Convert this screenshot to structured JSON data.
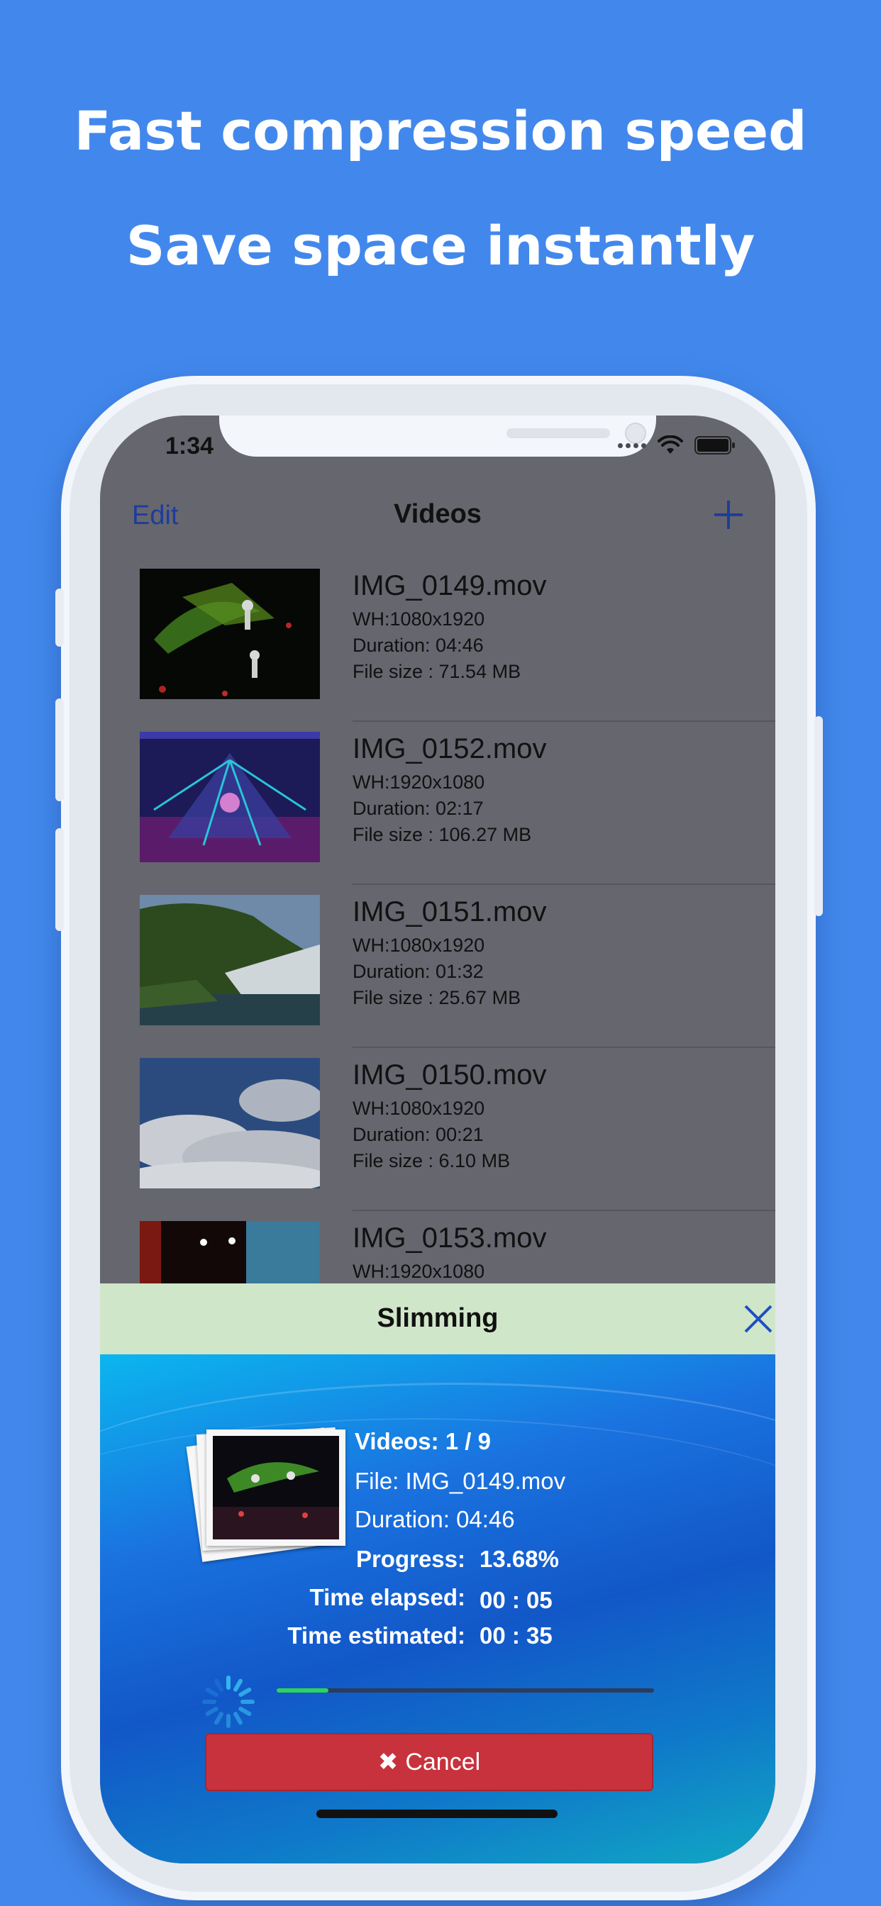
{
  "marketing": {
    "headline1": "Fast compression speed",
    "headline2": "Save space instantly"
  },
  "status_bar": {
    "time": "1:34"
  },
  "nav": {
    "edit": "Edit",
    "title": "Videos",
    "add_icon": "plus-icon"
  },
  "videos": [
    {
      "name": "IMG_0149.mov",
      "wh": "WH:1080x1920",
      "duration": "Duration: 04:46",
      "size": "File size : 71.54 MB"
    },
    {
      "name": "IMG_0152.mov",
      "wh": "WH:1920x1080",
      "duration": "Duration: 02:17",
      "size": "File size : 106.27 MB"
    },
    {
      "name": "IMG_0151.mov",
      "wh": "WH:1080x1920",
      "duration": "Duration: 01:32",
      "size": "File size : 25.67 MB"
    },
    {
      "name": "IMG_0150.mov",
      "wh": "WH:1080x1920",
      "duration": "Duration: 00:21",
      "size": "File size : 6.10 MB"
    },
    {
      "name": "IMG_0153.mov",
      "wh": "WH:1920x1080",
      "duration": "",
      "size": ""
    }
  ],
  "sheet": {
    "title": "Slimming",
    "close_icon": "close-icon",
    "videos_count": "Videos: 1 / 9",
    "file": "File: IMG_0149.mov",
    "duration": "Duration: 04:46",
    "progress_label": "Progress:",
    "progress_value": "13.68%",
    "progress_fraction": 0.1368,
    "elapsed_label": "Time elapsed:",
    "elapsed_value": "00 : 05",
    "estimated_label": "Time estimated:",
    "estimated_value": "00 : 35",
    "cancel_label": "Cancel"
  },
  "colors": {
    "background": "#4288ec",
    "nav_tint": "#1d3d9a",
    "sheet_header": "#d0e6c9",
    "cancel_button": "#c8323c",
    "progress_fill": "#2fd35a"
  }
}
